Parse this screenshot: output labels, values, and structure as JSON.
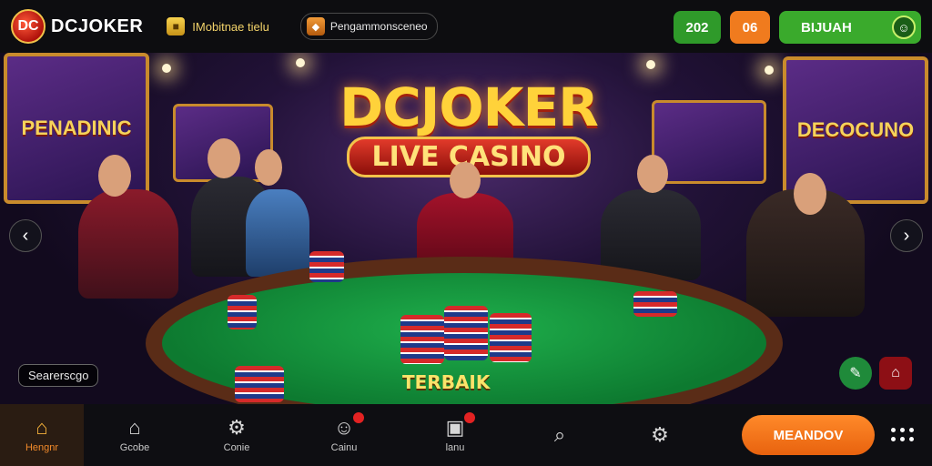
{
  "header": {
    "logo_mark": "DC",
    "brand": "DCJOKER",
    "nav_link_1": "IMobitnae tielu",
    "nav_link_2": "Pengammonsceneo",
    "chip_1": "202",
    "chip_2": "06",
    "cta_label": "BIJUAH"
  },
  "hero": {
    "headline": "DCJOKER",
    "subheadline": "LIVE CASINO",
    "left_frame_text": "PENADINIC",
    "right_frame_text": "DECOCUNO",
    "center_left_frame_text": "",
    "center_right_frame_text": "",
    "table_label": "TERBAIK",
    "tag_label": "Searerscgo",
    "prev_arrow": "‹",
    "next_arrow": "›"
  },
  "bottom_nav": {
    "items": [
      {
        "label": "Hengnr",
        "icon": "home-icon",
        "glyph": "⌂"
      },
      {
        "label": "Gcobe",
        "icon": "building-icon",
        "glyph": "⌂"
      },
      {
        "label": "Conie",
        "icon": "gear-icon",
        "glyph": "⚙"
      },
      {
        "label": "Cainu",
        "icon": "user-icon",
        "glyph": "☺"
      },
      {
        "label": "lanu",
        "icon": "image-icon",
        "glyph": "▣"
      },
      {
        "label": "",
        "icon": "search-icon",
        "glyph": "⌕"
      },
      {
        "label": "",
        "icon": "settings-icon",
        "glyph": "⚙"
      }
    ],
    "cta_label": "MEANDOV"
  },
  "colors": {
    "accent_orange": "#f07b1e",
    "accent_green": "#3aaa2c",
    "gold": "#ffd23a",
    "felt_green": "#1fb04c"
  }
}
